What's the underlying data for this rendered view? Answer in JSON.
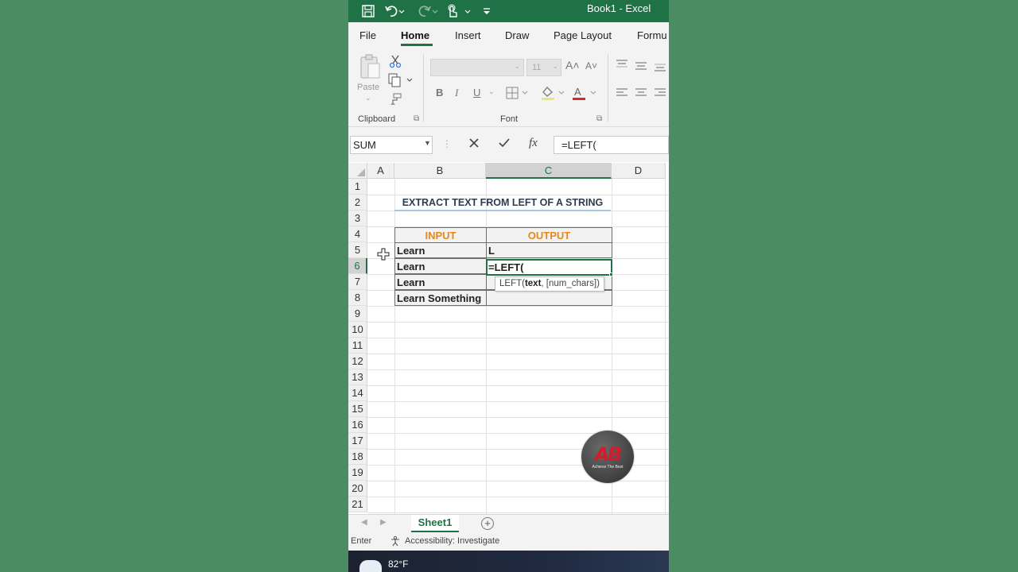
{
  "window": {
    "title": "Book1  -  Excel"
  },
  "tabs": [
    "File",
    "Home",
    "Insert",
    "Draw",
    "Page Layout",
    "Formu"
  ],
  "ribbon": {
    "paste_label": "Paste",
    "clipboard_label": "Clipboard",
    "font_label": "Font",
    "font_size": "11",
    "bold": "B",
    "italic": "I",
    "underline": "U"
  },
  "formula_bar": {
    "name_box": "SUM",
    "fx": "fx",
    "formula": "=LEFT("
  },
  "sheet": {
    "columns": [
      "A",
      "B",
      "C",
      "D"
    ],
    "rows": [
      "1",
      "2",
      "3",
      "4",
      "5",
      "6",
      "7",
      "8",
      "9",
      "10",
      "11",
      "12",
      "13",
      "14",
      "15",
      "16",
      "17",
      "18",
      "19",
      "20",
      "21"
    ],
    "title": "EXTRACT TEXT FROM LEFT OF A STRING",
    "header_input": "INPUT",
    "header_output": "OUTPUT",
    "inputs": [
      "Learn",
      "Learn",
      "Learn",
      "Learn Something"
    ],
    "output_row5": "L",
    "active_cell_text": "=LEFT(",
    "tooltip_func": "LEFT(",
    "tooltip_bold": "text",
    "tooltip_rest": ", [num_chars])"
  },
  "logo": {
    "mark": "AB",
    "text": "Achieve The Best"
  },
  "sheet_tabs": {
    "active": "Sheet1"
  },
  "status": {
    "mode": "Enter",
    "accessibility": "Accessibility: Investigate"
  },
  "taskbar": {
    "temperature": "82°F"
  },
  "colors": {
    "excel_green": "#1f7245",
    "header_orange": "#e8881a",
    "title_blue": "#2b3d4f"
  }
}
